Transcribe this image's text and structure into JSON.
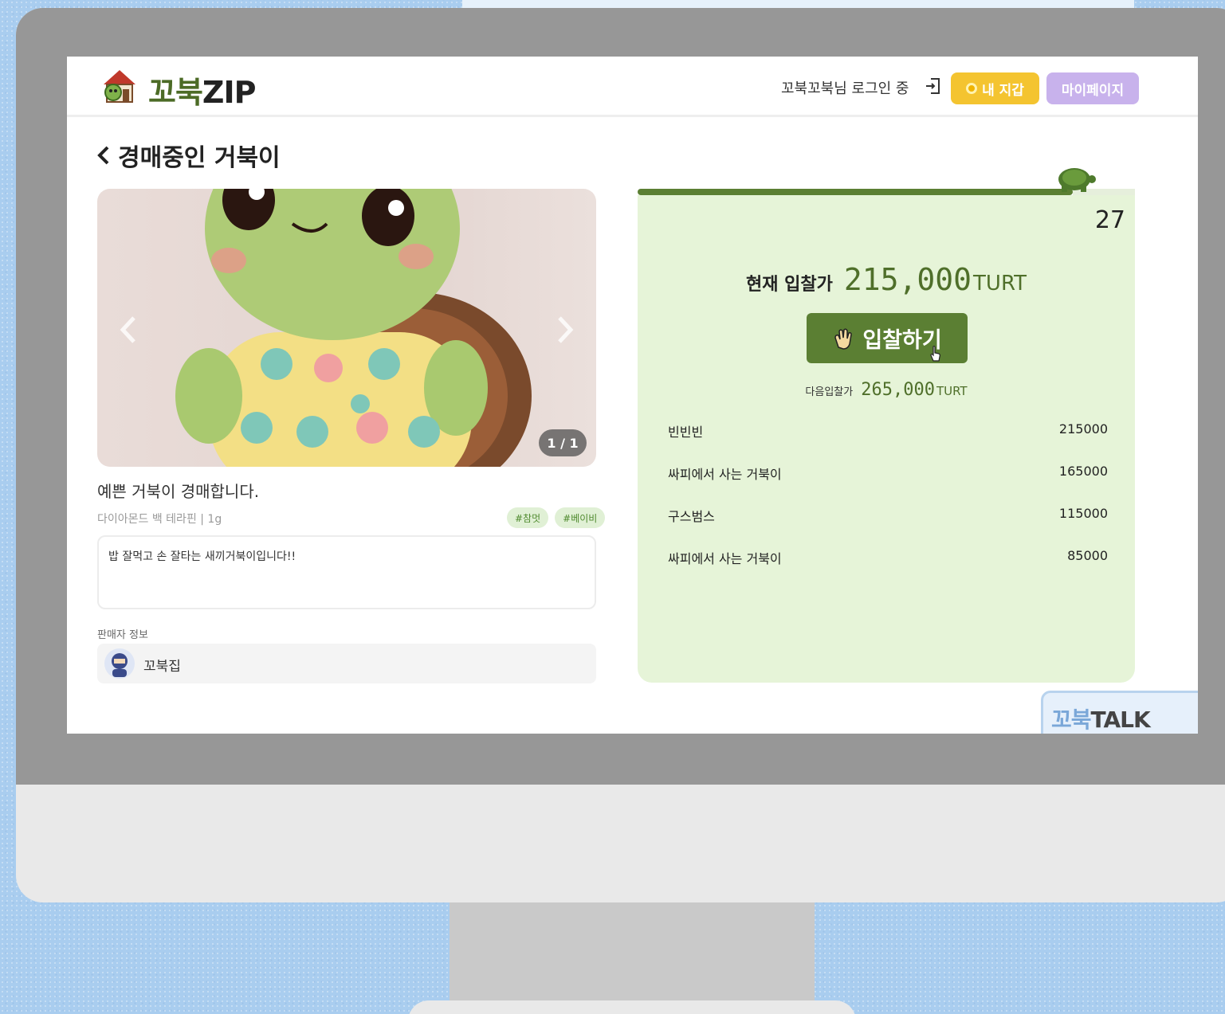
{
  "app": {
    "logo_korean": "꼬북",
    "logo_latin": "ZIP"
  },
  "header": {
    "login_status": "꼬북꼬북님 로그인 중",
    "wallet_label": "내 지갑",
    "mypage_label": "마이페이지"
  },
  "page": {
    "title": "경매중인 거북이"
  },
  "item": {
    "page_indicator": "1 / 1",
    "title": "예쁜 거북이 경매합니다.",
    "meta": "다이아몬드 백 테라핀 | 1g",
    "tags": [
      "#참멋",
      "#베이비"
    ],
    "description": "밥 잘먹고 손 잘타는 새끼거북이입니다!!",
    "seller_label": "판매자 정보",
    "seller_name": "꼬북집"
  },
  "auction": {
    "countdown": "27",
    "current_bid_label": "현재 입찰가",
    "current_bid_value": "215,000",
    "currency": "TURT",
    "bid_button_label": "입찰하기",
    "next_bid_label": "다음입찰가",
    "next_bid_value": "265,000",
    "bids": [
      {
        "name": "빈빈빈",
        "amount": "215000"
      },
      {
        "name": "싸피에서 사는 거북이",
        "amount": "165000"
      },
      {
        "name": "구스범스",
        "amount": "115000"
      },
      {
        "name": "싸피에서 사는 거북이",
        "amount": "85000"
      }
    ]
  },
  "talk": {
    "label_korean": "꼬북",
    "label_latin": "TALK"
  },
  "colors": {
    "brand_green": "#5b7f33",
    "panel_green": "#e6f4d8",
    "wallet_yellow": "#f4c430",
    "mypage_purple": "#c8b2ec"
  }
}
